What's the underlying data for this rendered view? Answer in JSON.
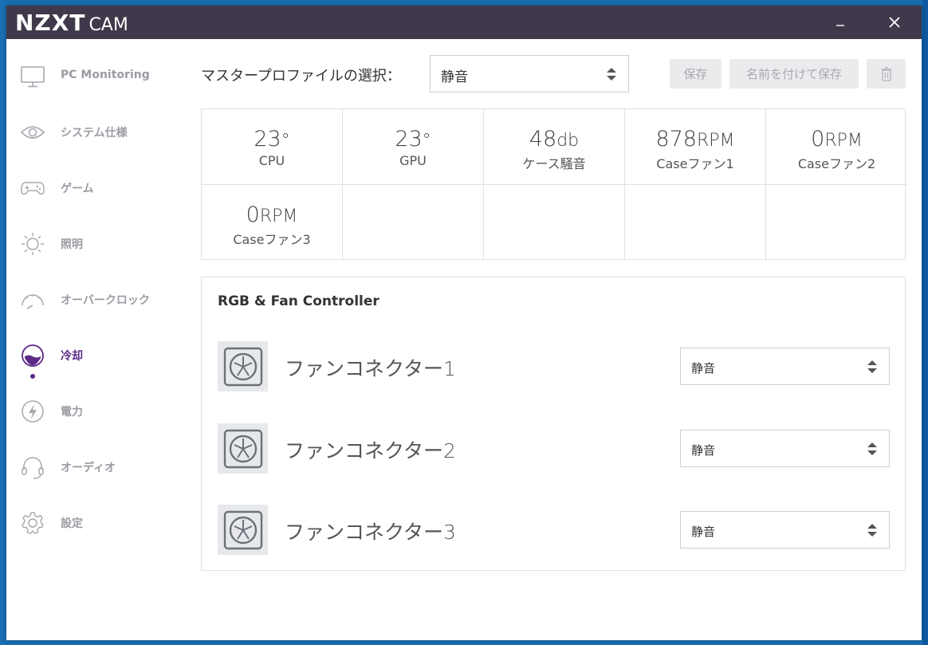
{
  "app": {
    "logo_main": "NZXT",
    "logo_sub": "CAM",
    "minimize_glyph": "–",
    "close_glyph": "✕"
  },
  "sidebar": {
    "items": [
      {
        "label": "PC Monitoring",
        "icon": "monitor-icon"
      },
      {
        "label": "システム仕様",
        "icon": "eye-icon"
      },
      {
        "label": "ゲーム",
        "icon": "gamepad-icon"
      },
      {
        "label": "照明",
        "icon": "sun-icon"
      },
      {
        "label": "オーバークロック",
        "icon": "gauge-icon"
      },
      {
        "label": "冷却",
        "icon": "cooling-icon",
        "active": true
      },
      {
        "label": "電力",
        "icon": "bolt-icon"
      },
      {
        "label": "オーディオ",
        "icon": "headset-icon"
      },
      {
        "label": "設定",
        "icon": "gear-icon"
      }
    ]
  },
  "profile": {
    "label": "マスタープロファイルの選択：",
    "selected": "静音",
    "save_label": "保存",
    "save_as_label": "名前を付けて保存"
  },
  "stats": [
    {
      "value": "23",
      "unit": "°",
      "label": "CPU"
    },
    {
      "value": "23",
      "unit": "°",
      "label": "GPU"
    },
    {
      "value": "48",
      "unit": "db",
      "label": "ケース騒音"
    },
    {
      "value": "878",
      "unit": "RPM",
      "label": "Caseファン1"
    },
    {
      "value": "0",
      "unit": "RPM",
      "label": "Caseファン2"
    },
    {
      "value": "0",
      "unit": "RPM",
      "label": "Caseファン3"
    }
  ],
  "controller": {
    "title": "RGB & Fan Controller",
    "fans": [
      {
        "name": "ファンコネクター1",
        "profile": "静音"
      },
      {
        "name": "ファンコネクター2",
        "profile": "静音"
      },
      {
        "name": "ファンコネクター3",
        "profile": "静音"
      }
    ]
  },
  "colors": {
    "titlebar": "#40394b",
    "accent": "#5b2a86",
    "desktop": "#1b6fb5"
  }
}
